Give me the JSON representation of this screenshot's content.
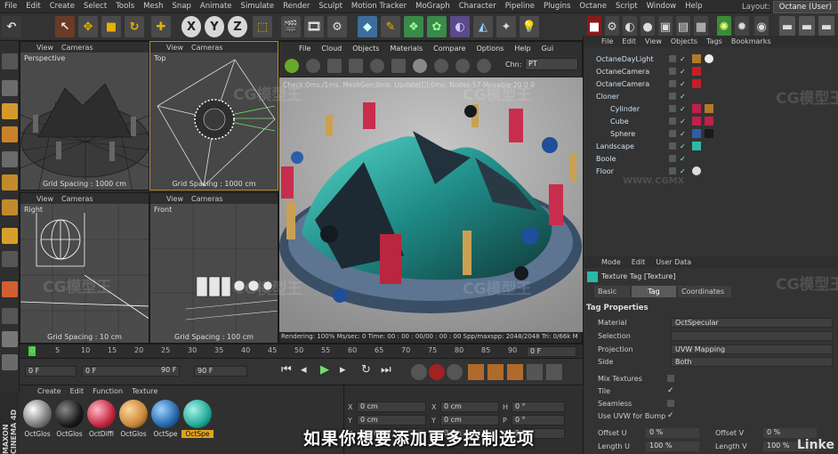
{
  "menubar": {
    "items": [
      "File",
      "Edit",
      "Create",
      "Select",
      "Tools",
      "Mesh",
      "Snap",
      "Animate",
      "Simulate",
      "Render",
      "Sculpt",
      "Motion Tracker",
      "MoGraph",
      "Character",
      "Pipeline",
      "Plugins",
      "Octane",
      "Script",
      "Window",
      "Help"
    ],
    "layout_label": "Layout:",
    "layout_value": "Octane (User)"
  },
  "toolbar": {
    "axis_x": "X",
    "axis_y": "Y",
    "axis_z": "Z"
  },
  "viewports": [
    {
      "menu": [
        "View",
        "Cameras"
      ],
      "label": "Perspective",
      "footer": "Grid Spacing : 1000 cm"
    },
    {
      "menu": [
        "View",
        "Cameras"
      ],
      "label": "Top",
      "footer": "Grid Spacing : 1000 cm"
    },
    {
      "menu": [
        "View",
        "Cameras"
      ],
      "label": "Right",
      "footer": "Grid Spacing : 10 cm"
    },
    {
      "menu": [
        "View",
        "Cameras"
      ],
      "label": "Front",
      "footer": "Grid Spacing : 100 cm"
    }
  ],
  "render_view": {
    "menu": [
      "File",
      "Cloud",
      "Objects",
      "Materials",
      "Compare",
      "Options",
      "Help",
      "Gui"
    ],
    "channel_label": "Chn:",
    "channel_value": "PT",
    "status": "Check:0ms./1ms. MeshGen:0ms. Update[C]:0ms. Nodes:57 Movable:20  0 0",
    "footer": "Rendering: 100%  Ms/sec: 0    Time: 00 : 00 : 00/00 : 00 : 00    Spp/maxspp: 2048/2048    Tri: 0/66k  M"
  },
  "object_manager": {
    "menu": [
      "File",
      "Edit",
      "View",
      "Objects",
      "Tags",
      "Bookmarks"
    ],
    "objects": [
      {
        "name": "OctaneDayLight",
        "indent": 0
      },
      {
        "name": "OctaneCamera",
        "indent": 0
      },
      {
        "name": "OctaneCamera",
        "indent": 0
      },
      {
        "name": "Cloner",
        "indent": 0
      },
      {
        "name": "Cylinder",
        "indent": 1
      },
      {
        "name": "Cube",
        "indent": 1
      },
      {
        "name": "Sphere",
        "indent": 1
      },
      {
        "name": "Landscape",
        "indent": 0
      },
      {
        "name": "Boole",
        "indent": 0
      },
      {
        "name": "Floor",
        "indent": 0
      }
    ]
  },
  "attributes": {
    "menu": [
      "Mode",
      "Edit",
      "User Data"
    ],
    "tag_title": "Texture Tag [Texture]",
    "tabs": [
      "Basic",
      "Tag",
      "Coordinates"
    ],
    "active_tab": "Tag",
    "section": "Tag Properties",
    "material_label": "Material",
    "material_value": "OctSpecular",
    "selection_label": "Selection",
    "selection_value": "",
    "projection_label": "Projection",
    "projection_value": "UVW Mapping",
    "side_label": "Side",
    "side_value": "Both",
    "mix_label": "Mix Textures",
    "tile_label": "Tile",
    "seamless_label": "Seamless",
    "uvw_label": "Use UVW for Bump",
    "offset_u_label": "Offset U",
    "offset_u_value": "0 %",
    "offset_v_label": "Offset V",
    "offset_v_value": "0 %",
    "length_u_label": "Length U",
    "length_u_value": "100 %",
    "length_v_label": "Length V",
    "length_v_value": "100 %"
  },
  "timeline": {
    "ticks": [
      "0",
      "5",
      "10",
      "15",
      "20",
      "25",
      "30",
      "35",
      "40",
      "45",
      "50",
      "55",
      "60",
      "65",
      "70",
      "75",
      "80",
      "85",
      "90"
    ],
    "end_frame": "0 F",
    "start_field": "0 F",
    "current_field": "0 F",
    "max_field": "90 F",
    "max_field2": "90 F"
  },
  "material_manager": {
    "menu": [
      "Create",
      "Edit",
      "Function",
      "Texture"
    ],
    "materials": [
      "OctGlos",
      "OctGlos",
      "OctDiffi",
      "OctGlos",
      "OctSpe",
      "OctSpe"
    ]
  },
  "coordinates": {
    "x_label": "X",
    "y_label": "Y",
    "z_label": "Z",
    "x_val": "0 cm",
    "y_val": "0 cm",
    "z_val": "0 cm",
    "h_label": "H",
    "p_label": "P",
    "b_label": "B",
    "h_val": "0 °",
    "p_val": "0 °",
    "b_val": "0 °"
  },
  "brand_text": "MAXON CINEMA 4D",
  "subtitle": "如果你想要添加更多控制选项",
  "watermark": "CG模型王",
  "watermark_url": "WWW.CGMX",
  "linked": "Linke"
}
